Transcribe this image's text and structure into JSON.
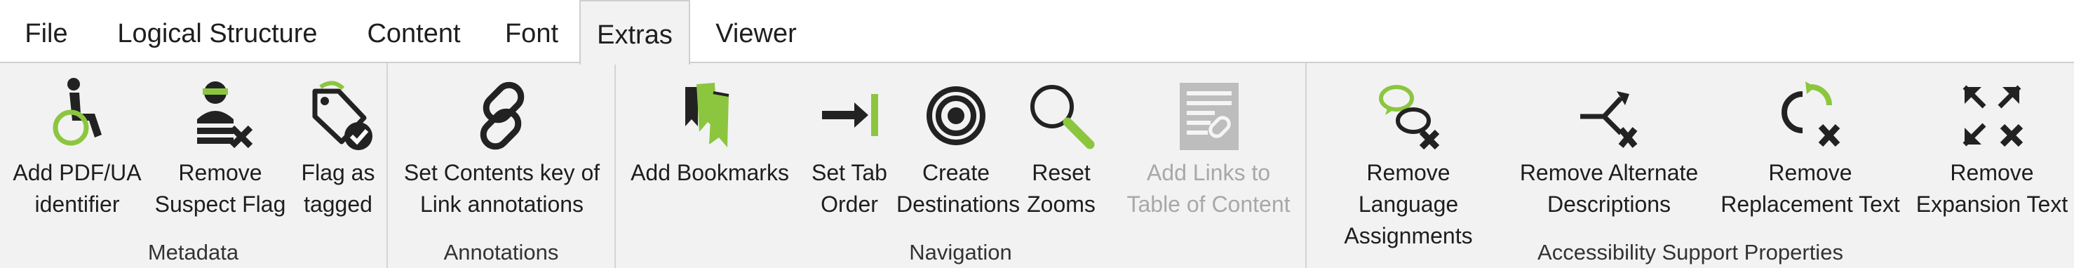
{
  "tabs": [
    {
      "label": "File"
    },
    {
      "label": "Logical Structure"
    },
    {
      "label": "Content"
    },
    {
      "label": "Font"
    },
    {
      "label": "Extras",
      "active": true
    },
    {
      "label": "Viewer"
    }
  ],
  "groups": {
    "metadata": {
      "label": "Metadata",
      "buttons": [
        {
          "label": "Add PDF/UA\nidentifier",
          "icon": "wheelchair-icon"
        },
        {
          "label": "Remove\nSuspect Flag",
          "icon": "suspect-remove-icon"
        },
        {
          "label": "Flag as\ntagged",
          "icon": "tag-check-icon"
        }
      ]
    },
    "annotations": {
      "label": "Annotations",
      "buttons": [
        {
          "label": "Set Contents key of\nLink annotations",
          "icon": "link-icon"
        }
      ]
    },
    "navigation": {
      "label": "Navigation",
      "buttons": [
        {
          "label": "Add Bookmarks",
          "icon": "bookmarks-icon"
        },
        {
          "label": "Set Tab\nOrder",
          "icon": "tab-order-icon"
        },
        {
          "label": "Create\nDestinations",
          "icon": "target-icon"
        },
        {
          "label": "Reset\nZooms",
          "icon": "magnifier-icon"
        },
        {
          "label": "Add Links to\nTable of Content",
          "icon": "toc-link-icon",
          "disabled": true
        }
      ]
    },
    "accessibility": {
      "label": "Accessibility Support Properties",
      "buttons": [
        {
          "label": "Remove Language\nAssignments",
          "icon": "language-remove-icon"
        },
        {
          "label": "Remove Alternate\nDescriptions",
          "icon": "alternate-remove-icon"
        },
        {
          "label": "Remove\nReplacement Text",
          "icon": "replacement-remove-icon"
        },
        {
          "label": "Remove\nExpansion Text",
          "icon": "expansion-remove-icon"
        }
      ]
    }
  },
  "colors": {
    "accent": "#8cc63f",
    "icon_dark": "#222222",
    "disabled": "#a8a8a8"
  }
}
